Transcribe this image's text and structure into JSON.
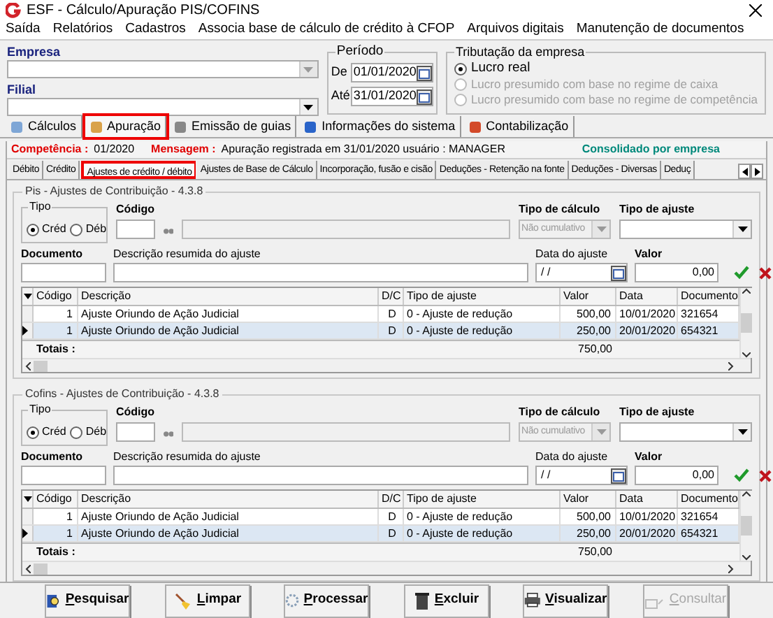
{
  "window": {
    "title": "ESF - Cálculo/Apuração PIS/COFINS"
  },
  "menu": [
    "Saída",
    "Relatórios",
    "Cadastros",
    "Associa base de cálculo de crédito à CFOP",
    "Arquivos digitais",
    "Manutenção de documentos"
  ],
  "empresa": {
    "label": "Empresa"
  },
  "filial": {
    "label": "Filial"
  },
  "periodo": {
    "title": "Período",
    "de_label": "De",
    "de_value": "01/01/2020",
    "ate_label": "Até",
    "ate_value": "31/01/2020"
  },
  "tributacao": {
    "title": "Tributação da empresa",
    "options": [
      {
        "label": "Lucro real",
        "selected": true,
        "disabled": false
      },
      {
        "label": "Lucro presumido com base no regime de caixa",
        "selected": false,
        "disabled": true
      },
      {
        "label": "Lucro presumido com base no regime de competência",
        "selected": false,
        "disabled": true
      }
    ]
  },
  "main_tabs": [
    {
      "label": "Cálculos",
      "selected": false
    },
    {
      "label": "Apuração",
      "selected": true
    },
    {
      "label": "Emissão de guias",
      "selected": false
    },
    {
      "label": "Informações do sistema",
      "selected": false
    },
    {
      "label": "Contabilização",
      "selected": false
    }
  ],
  "status": {
    "competencia_label": "Competência :",
    "competencia_value": "01/2020",
    "mensagem_label": "Mensagem :",
    "mensagem_value": "Apuração registrada em 31/01/2020 usuário : MANAGER",
    "consolidado": "Consolidado por empresa"
  },
  "sub_tabs": [
    {
      "label": "Débito",
      "selected": false
    },
    {
      "label": "Crédito",
      "selected": false
    },
    {
      "label": "Ajustes de crédito / débito",
      "selected": true
    },
    {
      "label": "Ajustes de Base de Cálculo",
      "selected": false
    },
    {
      "label": "Incorporação, fusão e cisão",
      "selected": false
    },
    {
      "label": "Deduções - Retenção na fonte",
      "selected": false
    },
    {
      "label": "Deduções - Diversas",
      "selected": false
    },
    {
      "label": "Deduç",
      "selected": false
    }
  ],
  "sections": [
    {
      "title": "Pis - Ajustes de Contribuição - 4.3.8",
      "tipo": {
        "title": "Tipo",
        "options": [
          {
            "label": "Créd",
            "selected": true
          },
          {
            "label": "Déb",
            "selected": false
          }
        ]
      },
      "codigo_label": "Código",
      "tipo_calculo_label": "Tipo de cálculo",
      "tipo_calculo_value": "Não cumulativo",
      "tipo_ajuste_label": "Tipo de ajuste",
      "documento_label": "Documento",
      "descricao_label": "Descrição resumida do ajuste",
      "data_label": "Data do ajuste",
      "data_value": "/ /",
      "valor_label": "Valor",
      "valor_value": "0,00",
      "columns": [
        "Código",
        "Descrição",
        "D/C",
        "Tipo de ajuste",
        "Valor",
        "Data",
        "Documento"
      ],
      "rows": [
        {
          "cells": [
            "1",
            "Ajuste Oriundo de Ação Judicial",
            "D",
            "0 - Ajuste de redução",
            "500,00",
            "10/01/2020",
            "321654"
          ],
          "selected": false
        },
        {
          "cells": [
            "1",
            "Ajuste Oriundo de Ação Judicial",
            "D",
            "0 - Ajuste de redução",
            "250,00",
            "20/01/2020",
            "654321"
          ],
          "selected": true
        }
      ],
      "totals_label": "Totais :",
      "totals_value": "750,00"
    },
    {
      "title": "Cofins - Ajustes de Contribuição - 4.3.8",
      "tipo": {
        "title": "Tipo",
        "options": [
          {
            "label": "Créd",
            "selected": true
          },
          {
            "label": "Déb",
            "selected": false
          }
        ]
      },
      "codigo_label": "Código",
      "tipo_calculo_label": "Tipo de cálculo",
      "tipo_calculo_value": "Não cumulativo",
      "tipo_ajuste_label": "Tipo de ajuste",
      "documento_label": "Documento",
      "descricao_label": "Descrição resumida do ajuste",
      "data_label": "Data do ajuste",
      "data_value": "/ /",
      "valor_label": "Valor",
      "valor_value": "0,00",
      "columns": [
        "Código",
        "Descrição",
        "D/C",
        "Tipo de ajuste",
        "Valor",
        "Data",
        "Documento"
      ],
      "rows": [
        {
          "cells": [
            "1",
            "Ajuste Oriundo de Ação Judicial",
            "D",
            "0 - Ajuste de redução",
            "500,00",
            "10/01/2020",
            "321654"
          ],
          "selected": false
        },
        {
          "cells": [
            "1",
            "Ajuste Oriundo de Ação Judicial",
            "D",
            "0 - Ajuste de redução",
            "250,00",
            "20/01/2020",
            "654321"
          ],
          "selected": true
        }
      ],
      "totals_label": "Totais :",
      "totals_value": "750,00"
    }
  ],
  "buttons": [
    {
      "label": "Pesquisar",
      "kind": "search",
      "disabled": false
    },
    {
      "label": "Limpar",
      "kind": "broom",
      "disabled": false
    },
    {
      "label": "Processar",
      "kind": "gear",
      "disabled": false
    },
    {
      "label": "Excluir",
      "kind": "trash",
      "disabled": false
    },
    {
      "label": "Visualizar",
      "kind": "print",
      "disabled": false
    },
    {
      "label": "Consultar",
      "kind": "query",
      "disabled": true
    }
  ]
}
